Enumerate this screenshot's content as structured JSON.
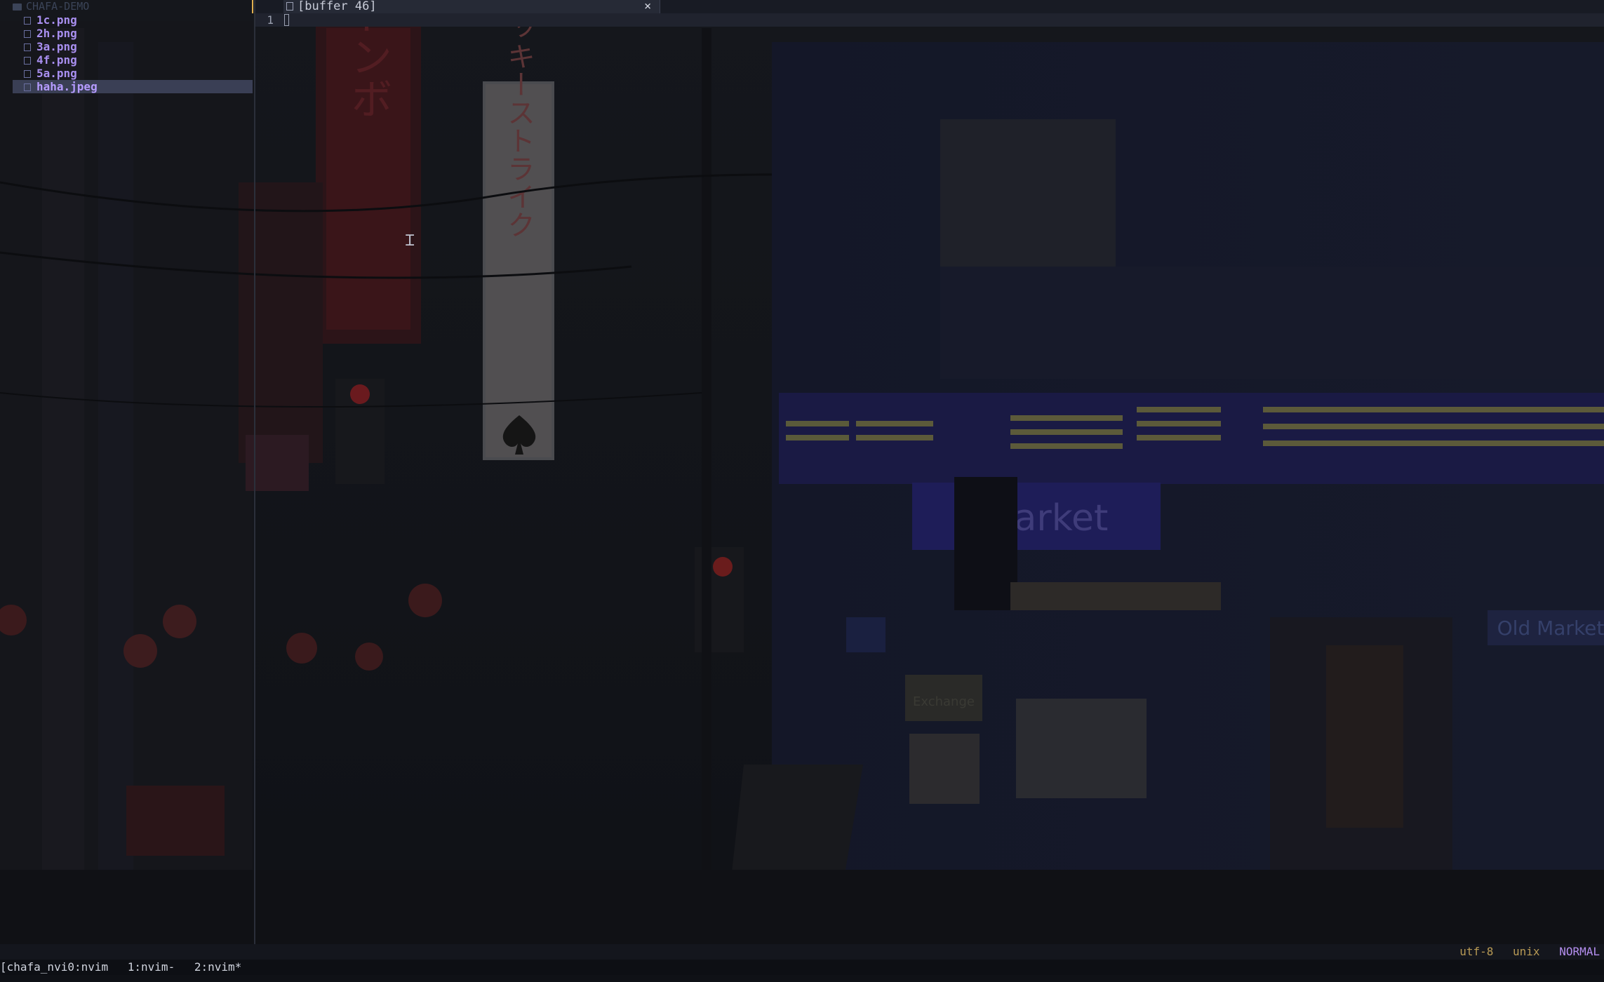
{
  "explorer": {
    "root": "CHAFA-DEMO",
    "files": [
      {
        "name": "1c.png",
        "selected": false
      },
      {
        "name": "2h.png",
        "selected": false
      },
      {
        "name": "3a.png",
        "selected": false
      },
      {
        "name": "4f.png",
        "selected": false
      },
      {
        "name": "5a.png",
        "selected": false
      },
      {
        "name": "haha.jpeg",
        "selected": true
      }
    ]
  },
  "tabs": [
    {
      "label": "[buffer 46]",
      "close": "×"
    }
  ],
  "editor": {
    "line_numbers": [
      "1"
    ],
    "background_signs": {
      "vertical": "ラッキーストライク",
      "left_vertical": "トンボ",
      "market": "Market",
      "old_market": "Old Market",
      "small_sign": "Exchange"
    }
  },
  "statusline": {
    "encoding": "utf-8",
    "fileformat": "unix",
    "mode": "NORMAL"
  },
  "tmux": {
    "session": "[chafa_nvi0:nvim",
    "windows": [
      "1:nvim-",
      "2:nvim*"
    ]
  },
  "colors": {
    "accent": "#a98ff0",
    "mode": "#b58ff0",
    "status_text": "#b89a55",
    "background": "#0d0f14"
  },
  "icons": {
    "folder": "folder-icon",
    "file": "image-file-icon",
    "tab_file": "document-icon",
    "close": "close-icon",
    "mouse": "text-cursor-icon"
  }
}
